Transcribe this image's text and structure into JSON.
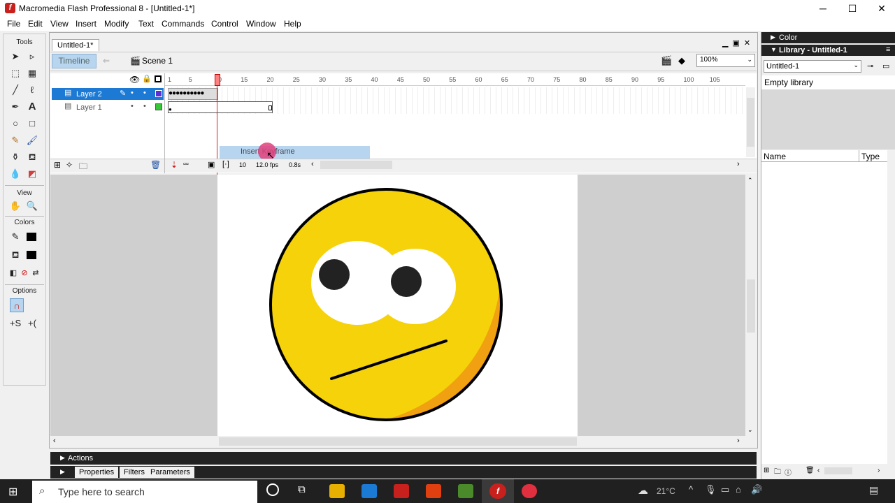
{
  "window": {
    "title": "Macromedia Flash Professional 8 - [Untitled-1*]",
    "minimize": "─",
    "maximize": "☐",
    "close": "✕"
  },
  "menu": [
    "File",
    "Edit",
    "View",
    "Insert",
    "Modify",
    "Text",
    "Commands",
    "Control",
    "Window",
    "Help"
  ],
  "tools": {
    "heading": "Tools",
    "view_heading": "View",
    "colors_heading": "Colors",
    "options_heading": "Options"
  },
  "document": {
    "tab": "Untitled-1*",
    "timeline_button": "Timeline",
    "scene": "Scene 1",
    "zoom": "100%"
  },
  "timeline": {
    "ruler": [
      "1",
      "5",
      "10",
      "15",
      "20",
      "25",
      "30",
      "35",
      "40",
      "45",
      "50",
      "55",
      "60",
      "65",
      "70",
      "75",
      "80",
      "85",
      "90",
      "95",
      "100",
      "105"
    ],
    "layers": [
      {
        "name": "Layer 2",
        "selected": true,
        "color": "#5b2fd6"
      },
      {
        "name": "Layer 1",
        "selected": false,
        "color": "#37c837"
      }
    ],
    "current_frame": "10",
    "fps": "12.0 fps",
    "elapsed": "0.8s",
    "context_menu_item": "Insert Keyframe"
  },
  "panels": {
    "actions": "Actions",
    "properties": "Properties",
    "filters": "Filters",
    "parameters": "Parameters",
    "color": "Color",
    "library_title": "Library - Untitled-1",
    "library_select": "Untitled-1",
    "library_status": "Empty library",
    "col_name": "Name",
    "col_type": "Type"
  },
  "taskbar": {
    "search_placeholder": "Type here to search",
    "temperature": "21°C"
  },
  "colors": {
    "face": "#f5d20a",
    "face_shade": "#f0a010",
    "accent_selected": "#1c7ad4"
  }
}
